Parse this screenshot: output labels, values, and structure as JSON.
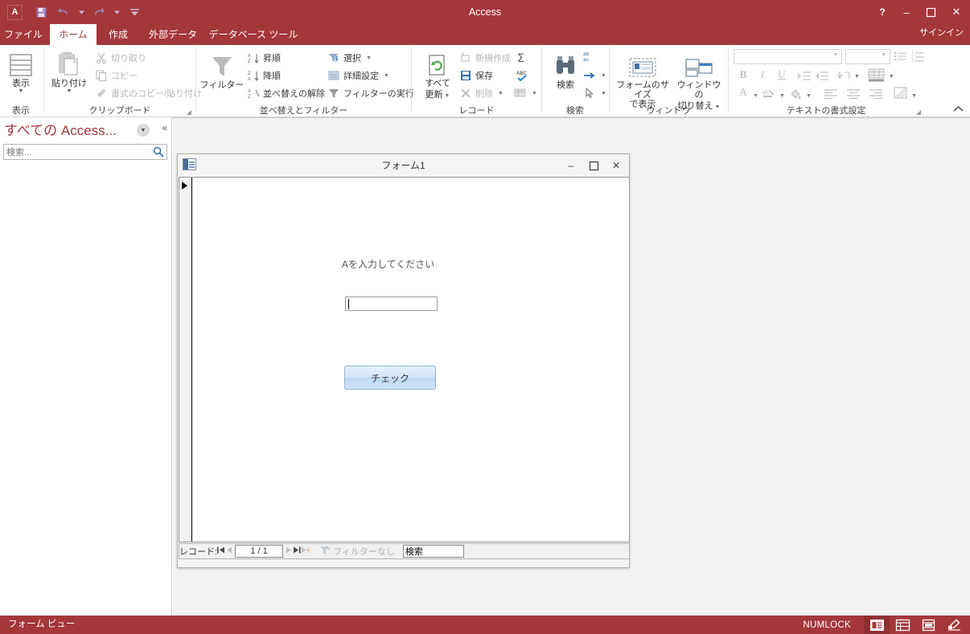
{
  "app": {
    "title": "Access",
    "icon": "access-app-icon",
    "signin": "サインイン"
  },
  "quick_access": {
    "save": "save-icon",
    "undo": "undo-icon",
    "redo": "redo-icon",
    "customize": "customize-qat-icon"
  },
  "window_controls": {
    "help": "?",
    "minimize": "–",
    "maximize": "❑",
    "close": "✕"
  },
  "tabs": [
    {
      "label": "ファイル",
      "active": false,
      "file": true
    },
    {
      "label": "ホーム",
      "active": true
    },
    {
      "label": "作成",
      "active": false
    },
    {
      "label": "外部データ",
      "active": false
    },
    {
      "label": "データベース ツール",
      "active": false
    }
  ],
  "ribbon": {
    "collapse_icon": "chevron-up-icon",
    "groups": [
      {
        "name": "view",
        "label": "表示",
        "big_buttons": [
          {
            "label": "表示",
            "icon": "view-datasheet-icon",
            "has_caret": true
          }
        ]
      },
      {
        "name": "clipboard",
        "label": "クリップボード",
        "big_buttons": [
          {
            "label": "貼り付け",
            "icon": "paste-icon",
            "has_caret": true
          }
        ],
        "items": [
          {
            "label": "切り取り",
            "icon": "cut-icon",
            "disabled": true
          },
          {
            "label": "コピー",
            "icon": "copy-icon",
            "disabled": true
          },
          {
            "label": "書式のコピー/貼り付け",
            "icon": "format-painter-icon",
            "disabled": true
          }
        ],
        "dialog_launcher": true
      },
      {
        "name": "sort-filter",
        "label": "並べ替えとフィルター",
        "big_buttons": [
          {
            "label": "フィルター",
            "icon": "filter-funnel-icon",
            "has_caret": false
          }
        ],
        "items": [
          {
            "label": "昇順",
            "icon": "sort-ascending-icon",
            "disabled": false
          },
          {
            "label": "降順",
            "icon": "sort-descending-icon",
            "disabled": false
          },
          {
            "label": "並べ替えの解除",
            "icon": "clear-sort-icon",
            "disabled": false
          },
          {
            "label": "選択",
            "icon": "selection-icon",
            "disabled": false,
            "has_caret": true
          },
          {
            "label": "詳細設定",
            "icon": "advanced-filter-icon",
            "disabled": false,
            "has_caret": true
          },
          {
            "label": "フィルターの実行",
            "icon": "toggle-filter-icon",
            "disabled": false
          }
        ]
      },
      {
        "name": "records",
        "label": "レコード",
        "big_buttons": [
          {
            "label_line1": "すべて",
            "label_line2": "更新",
            "icon": "refresh-all-icon",
            "has_caret": true
          }
        ],
        "items": [
          {
            "label": "新規作成",
            "icon": "new-record-icon",
            "disabled": true
          },
          {
            "label": "保存",
            "icon": "save-record-icon",
            "disabled": false
          },
          {
            "label": "削除",
            "icon": "delete-record-icon",
            "disabled": true,
            "has_caret": true
          },
          {
            "label": "",
            "icon": "totals-sigma-icon",
            "disabled": false
          },
          {
            "label": "",
            "icon": "spelling-abc-icon",
            "disabled": false
          },
          {
            "label": "",
            "icon": "more-grid-icon",
            "disabled": true,
            "has_caret": true
          }
        ]
      },
      {
        "name": "find",
        "label": "検索",
        "big_buttons": [
          {
            "label": "検索",
            "icon": "find-binoculars-icon",
            "has_caret": false
          }
        ],
        "items": [
          {
            "label": "",
            "icon": "replace-abac-icon",
            "disabled": true
          },
          {
            "label": "",
            "icon": "goto-arrow-icon",
            "disabled": false,
            "has_caret": true
          },
          {
            "label": "",
            "icon": "select-cursor-icon",
            "disabled": false,
            "has_caret": true
          }
        ]
      },
      {
        "name": "window",
        "label": "ウィンドウ",
        "big_buttons": [
          {
            "label_line1": "フォームのサイズ",
            "label_line2": "で表示",
            "icon": "size-to-form-icon",
            "has_caret": false
          },
          {
            "label_line1": "ウィンドウの",
            "label_line2": "切り替え",
            "icon": "switch-windows-icon",
            "has_caret": true
          }
        ]
      },
      {
        "name": "text-formatting",
        "label": "テキストの書式設定",
        "font_name": "",
        "font_size": "",
        "items": [
          {
            "icon": "bullets-icon",
            "disabled": true,
            "has_caret": false
          },
          {
            "icon": "numbering-icon",
            "disabled": true,
            "has_caret": false
          },
          {
            "icon": "bold-icon",
            "label": "B",
            "disabled": true
          },
          {
            "icon": "italic-icon",
            "label": "I",
            "disabled": true
          },
          {
            "icon": "underline-icon",
            "label": "U",
            "disabled": true
          },
          {
            "icon": "increase-indent-icon",
            "disabled": true
          },
          {
            "icon": "decrease-indent-icon",
            "disabled": true
          },
          {
            "icon": "text-direction-icon",
            "disabled": true,
            "has_caret": true
          },
          {
            "icon": "gridlines-icon",
            "disabled": true,
            "has_caret": true
          },
          {
            "icon": "font-color-icon",
            "label": "A",
            "disabled": true,
            "has_caret": true
          },
          {
            "icon": "text-highlight-icon",
            "disabled": true,
            "has_caret": true
          },
          {
            "icon": "background-color-icon",
            "disabled": true,
            "has_caret": true
          },
          {
            "icon": "align-left-icon",
            "disabled": true
          },
          {
            "icon": "align-center-icon",
            "disabled": true
          },
          {
            "icon": "align-right-icon",
            "disabled": true
          },
          {
            "icon": "alternate-row-color-icon",
            "disabled": true,
            "has_caret": true
          }
        ],
        "dialog_launcher": true
      }
    ]
  },
  "navpane": {
    "title": "すべての Access...",
    "dropdown_icon": "chevron-down-icon",
    "collapse_icon": "double-chevron-left-icon",
    "search_placeholder": "検索...",
    "search_value": "",
    "search_icon": "search-magnifier-icon"
  },
  "form_window": {
    "icon": "form-object-icon",
    "title": "フォーム1",
    "minimize": "–",
    "maximize": "❑",
    "close": "✕",
    "record_selector_icon": "record-selector-arrow-icon",
    "label": "Aを入力してください",
    "input_value": "",
    "button_label": "チェック",
    "navigator": {
      "record_label": "レコード:",
      "first_icon": "❘◀",
      "prev_icon": "◀",
      "record_position": "1 / 1",
      "next_icon": "▶",
      "last_icon": "▶❘",
      "new_icon": "▶✻",
      "filter_icon": "filter-off-icon",
      "filter_label": "フィルターなし",
      "search_placeholder": "検索",
      "search_value": "検索"
    }
  },
  "statusbar": {
    "view_name": "フォーム ビュー",
    "numlock": "NUMLOCK",
    "view_buttons": [
      {
        "name": "form-view-button",
        "icon": "form-view-icon",
        "selected": true
      },
      {
        "name": "datasheet-view-button",
        "icon": "datasheet-view-icon",
        "selected": false
      },
      {
        "name": "layout-view-button",
        "icon": "layout-view-icon",
        "selected": false
      },
      {
        "name": "design-view-button",
        "icon": "design-view-icon",
        "selected": false
      }
    ]
  },
  "colors": {
    "accent": "#a4373a",
    "workspace": "#f2f2f2",
    "button_blue": "#bcd9f3"
  }
}
